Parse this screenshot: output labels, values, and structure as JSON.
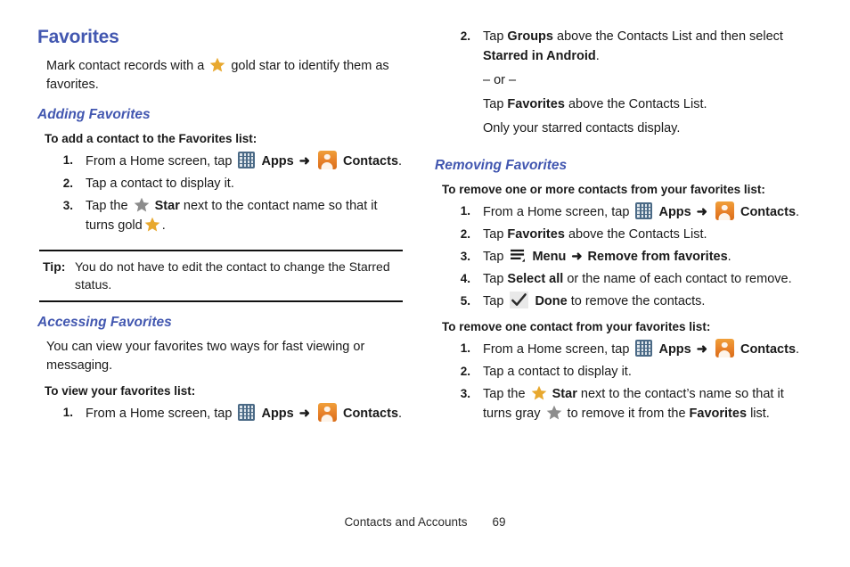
{
  "page": {
    "title": "Favorites",
    "intro_before": "Mark contact records with a",
    "intro_after": "gold star to identify them as favorites."
  },
  "icons": {
    "apps": "apps-grid-icon",
    "contacts": "contacts-person-icon",
    "star_gold": "gold-star-icon",
    "star_gray": "gray-star-icon",
    "menu": "menu-icon",
    "done": "checkmark-icon",
    "arrow": "➜"
  },
  "colors": {
    "heading_blue": "#4257b0",
    "star_gold": "#e8a82e",
    "star_gray": "#8c8c8c",
    "apps_blue": "#4b6a86",
    "contacts_orange": "#e8822a"
  },
  "labels": {
    "apps": "Apps",
    "contacts": "Contacts",
    "star": "Star",
    "menu": "Menu",
    "done": "Done",
    "groups": "Groups",
    "starred_in_android": "Starred in Android",
    "favorites": "Favorites",
    "select_all": "Select all",
    "remove_from_favorites": "Remove from favorites",
    "tip_label": "Tip:"
  },
  "sections": {
    "adding": {
      "title": "Adding Favorites",
      "lead_in": "To add a contact to the Favorites list:",
      "step1_pre": "From a Home screen, tap",
      "step1_mid": "",
      "step1_end": ".",
      "step2": "Tap a contact to display it.",
      "step3_pre": "Tap the",
      "step3_mid": "next to the contact name so that it turns gold",
      "step3_end": "."
    },
    "tip": {
      "text": "You do not have to edit the contact to change the Starred status."
    },
    "accessing": {
      "title": "Accessing Favorites",
      "body": "You can view your favorites two ways for fast viewing or messaging.",
      "lead_in": "To view your favorites list:",
      "step1_pre": "From a Home screen, tap",
      "step1_end": ".",
      "step2_pre": "Tap",
      "step2_mid": "above the Contacts List and then select",
      "step2_end": ".",
      "or": "– or –",
      "alt_pre": "Tap",
      "alt_end": "above the Contacts List.",
      "note": "Only your starred contacts display."
    },
    "removing": {
      "title": "Removing Favorites",
      "lead_in_multi": "To remove one or more contacts from your favorites list:",
      "m_step1_pre": "From a Home screen, tap",
      "m_step1_end": ".",
      "m_step2_pre": "Tap",
      "m_step2_end": "above the Contacts List.",
      "m_step3_pre": "Tap",
      "m_step3_end": ".",
      "m_step4_pre": "Tap",
      "m_step4_end": "or the name of each contact to remove.",
      "m_step5_pre": "Tap",
      "m_step5_end": "to remove the contacts.",
      "lead_in_one": "To remove one contact from your favorites list:",
      "o_step1_pre": "From a Home screen, tap",
      "o_step1_end": ".",
      "o_step2": "Tap a contact to display it.",
      "o_step3_pre": "Tap the",
      "o_step3_mid": "next to the contact’s name so that it turns gray",
      "o_step3_mid2": "to remove it from the",
      "o_step3_end": "list."
    }
  },
  "numbers": {
    "n1": "1.",
    "n2": "2.",
    "n3": "3.",
    "n4": "4.",
    "n5": "5."
  },
  "footer": {
    "chapter": "Contacts and Accounts",
    "page_number": "69"
  }
}
